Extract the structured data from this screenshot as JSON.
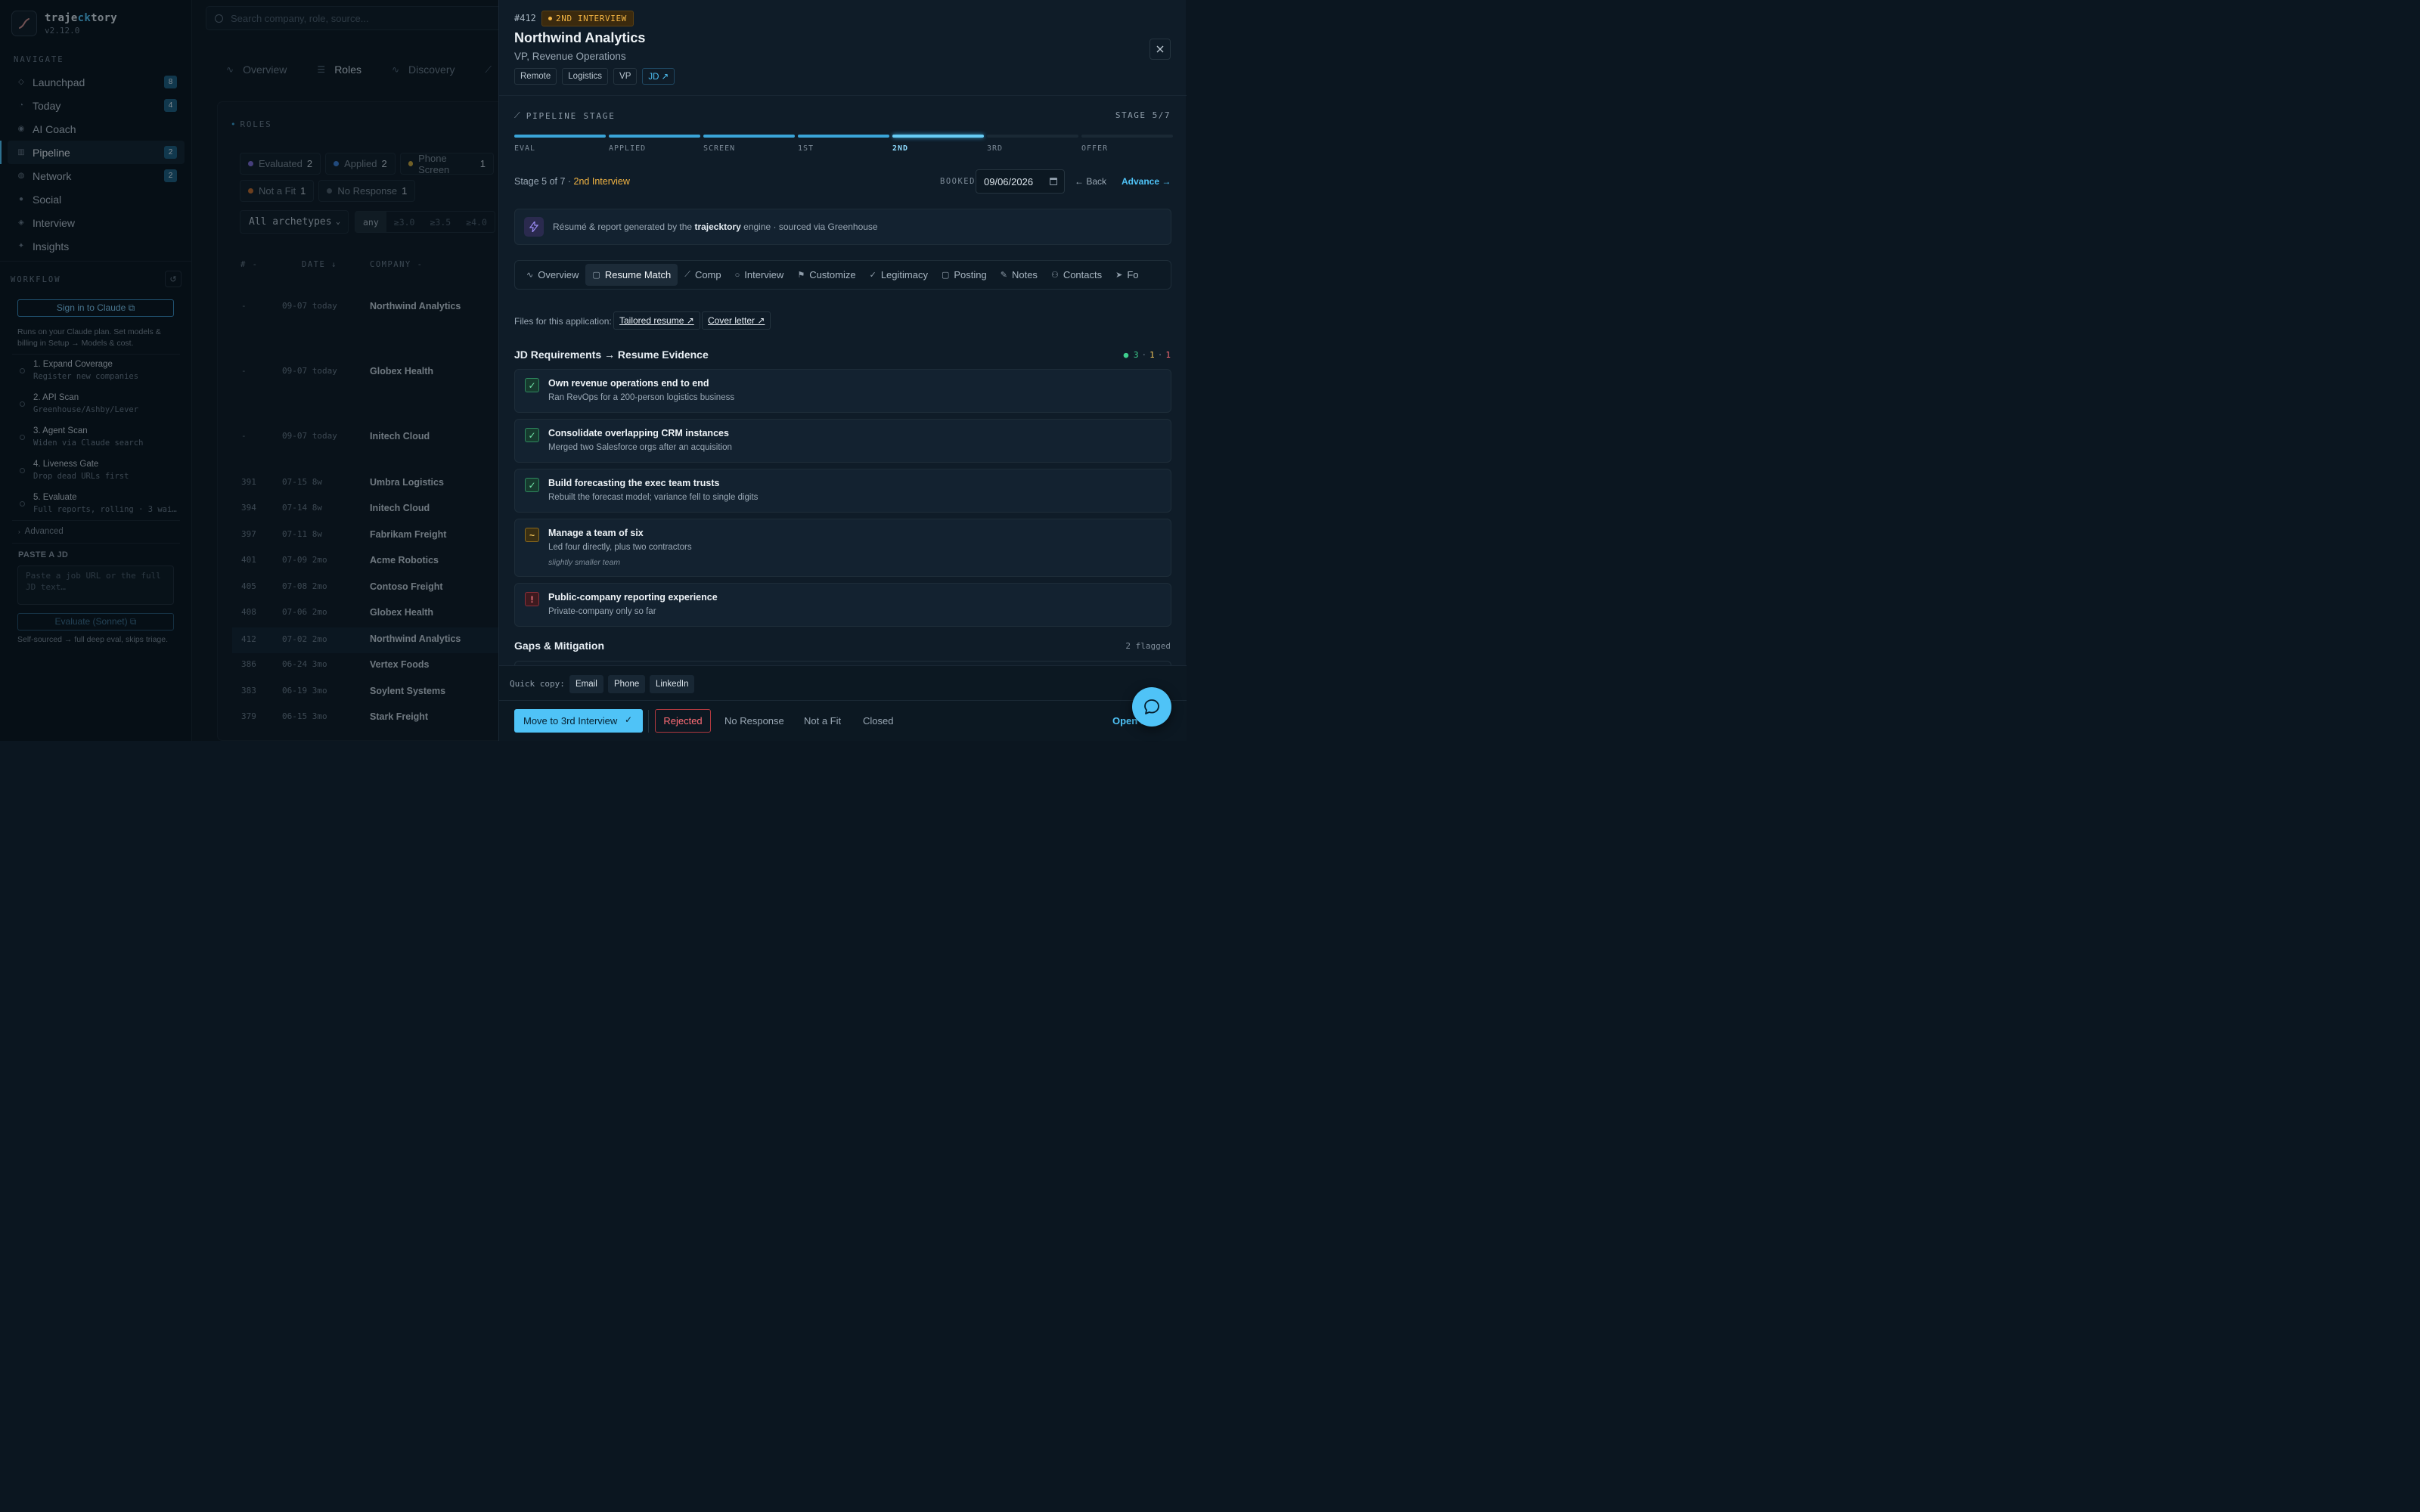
{
  "brand": {
    "name_prefix": "traje",
    "name_accent": "ck",
    "name_suffix": "tory",
    "version": "v2.12.0"
  },
  "sidebar": {
    "navigate_label": "NAVIGATE",
    "items": [
      {
        "label": "Launchpad",
        "icon": "diamond-icon",
        "badge": "8"
      },
      {
        "label": "Today",
        "icon": "clock-icon",
        "badge": "4"
      },
      {
        "label": "AI Coach",
        "icon": "target-icon",
        "badge": ""
      },
      {
        "label": "Pipeline",
        "icon": "grid-icon",
        "badge": "2",
        "active": true
      },
      {
        "label": "Network",
        "icon": "globe-icon",
        "badge": "2"
      },
      {
        "label": "Social",
        "icon": "circle-icon",
        "badge": ""
      },
      {
        "label": "Interview",
        "icon": "diamond-icon",
        "badge": ""
      },
      {
        "label": "Insights",
        "icon": "sparkle-icon",
        "badge": ""
      }
    ],
    "workflow_label": "WORKFLOW",
    "sign_in_label": "Sign in to Claude ⧉",
    "sign_in_note": "Runs on your Claude plan. Set models & billing in Setup → Models & cost.",
    "workflow_steps": [
      {
        "title": "1. Expand Coverage",
        "sub": "Register new companies"
      },
      {
        "title": "2. API Scan",
        "sub": "Greenhouse/Ashby/Lever"
      },
      {
        "title": "3. Agent Scan",
        "sub": "Widen via Claude search"
      },
      {
        "title": "4. Liveness Gate",
        "sub": "Drop dead URLs first"
      },
      {
        "title": "5. Evaluate",
        "sub": "Full reports, rolling · 3 wai…"
      }
    ],
    "advanced_label": "Advanced",
    "paste_label": "PASTE A JD",
    "paste_placeholder": "Paste a job URL or the full JD text…",
    "evaluate_label": "Evaluate (Sonnet) ⧉",
    "evaluate_note": "Self-sourced → full deep eval, skips triage."
  },
  "main": {
    "search_placeholder": "Search company, role, source...",
    "tabs": [
      "Overview",
      "Roles",
      "Discovery",
      "A"
    ],
    "roles_label": "ROLES",
    "filters_row1": [
      {
        "label": "Evaluated",
        "count": "2",
        "color": "#7d6bd6"
      },
      {
        "label": "Applied",
        "count": "2",
        "color": "#3a7fd8"
      },
      {
        "label": "Phone Screen",
        "count": "1",
        "color": "#c9a43a"
      }
    ],
    "filters_row2": [
      {
        "label": "Not a Fit",
        "count": "1",
        "color": "#c26a2a"
      },
      {
        "label": "No Response",
        "count": "1",
        "color": "#4f5d6a"
      }
    ],
    "archetype": "All archetypes",
    "score_options": [
      "any",
      "≥3.0",
      "≥3.5",
      "≥4.0"
    ],
    "col_id": "# -",
    "col_date": "DATE ↓",
    "col_company": "COMPANY -",
    "rows": [
      {
        "id": "-",
        "date": "09-07",
        "age": "today",
        "company": "Northwind Analytics"
      },
      {
        "id": "-",
        "date": "09-07",
        "age": "today",
        "company": "Globex Health"
      },
      {
        "id": "-",
        "date": "09-07",
        "age": "today",
        "company": "Initech Cloud"
      },
      {
        "id": "391",
        "date": "07-15",
        "age": "8w",
        "company": "Umbra Logistics"
      },
      {
        "id": "394",
        "date": "07-14",
        "age": "8w",
        "company": "Initech Cloud"
      },
      {
        "id": "397",
        "date": "07-11",
        "age": "8w",
        "company": "Fabrikam Freight"
      },
      {
        "id": "401",
        "date": "07-09",
        "age": "2mo",
        "company": "Acme Robotics"
      },
      {
        "id": "405",
        "date": "07-08",
        "age": "2mo",
        "company": "Contoso Freight"
      },
      {
        "id": "408",
        "date": "07-06",
        "age": "2mo",
        "company": "Globex Health"
      },
      {
        "id": "412",
        "date": "07-02",
        "age": "2mo",
        "company": "Northwind Analytics"
      },
      {
        "id": "386",
        "date": "06-24",
        "age": "3mo",
        "company": "Vertex Foods"
      },
      {
        "id": "383",
        "date": "06-19",
        "age": "3mo",
        "company": "Soylent Systems"
      },
      {
        "id": "379",
        "date": "06-15",
        "age": "3mo",
        "company": "Stark Freight"
      }
    ]
  },
  "drawer": {
    "id": "#412",
    "stage_badge": "2ND INTERVIEW",
    "company": "Northwind Analytics",
    "role": "VP, Revenue Operations",
    "tags": [
      "Remote",
      "Logistics",
      "VP",
      "JD ↗"
    ],
    "pipeline_label": "PIPELINE STAGE",
    "stage_count": "STAGE 5/7",
    "stages": [
      "EVAL",
      "APPLIED",
      "SCREEN",
      "1ST",
      "2ND",
      "3RD",
      "OFFER"
    ],
    "current_stage_index": 4,
    "stage_text_prefix": "Stage 5 of 7 · ",
    "stage_text_highlight": "2nd Interview",
    "booked_label": "BOOKED",
    "booked_date": "09/06/2026",
    "back_label": "← Back",
    "advance_label": "Advance →",
    "banner_prefix": "Résumé & report generated by the ",
    "banner_bold": "trajecktory",
    "banner_suffix": " engine · sourced via Greenhouse",
    "tabs": [
      {
        "label": "Overview",
        "icon": "pulse-icon"
      },
      {
        "label": "Resume Match",
        "icon": "briefcase-icon",
        "active": true
      },
      {
        "label": "Comp",
        "icon": "trend-icon"
      },
      {
        "label": "Interview",
        "icon": "chat-icon"
      },
      {
        "label": "Customize",
        "icon": "flag-icon"
      },
      {
        "label": "Legitimacy",
        "icon": "check-icon"
      },
      {
        "label": "Posting",
        "icon": "briefcase-icon"
      },
      {
        "label": "Notes",
        "icon": "pencil-icon"
      },
      {
        "label": "Contacts",
        "icon": "people-icon"
      },
      {
        "label": "Fo",
        "icon": "send-icon"
      }
    ],
    "files_label": "Files for this application:",
    "tailored_resume": "Tailored resume ↗",
    "cover_letter": "Cover letter ↗",
    "requirements_title": "JD Requirements → Resume Evidence",
    "tally": {
      "met": "3",
      "partial": "1",
      "gap": "1",
      "met_color": "#3ecf8e",
      "partial_color": "#f2c55a",
      "gap_color": "#ff6d76"
    },
    "requirements": [
      {
        "status": "ok",
        "symbol": "✓",
        "title": "Own revenue operations end to end",
        "evidence": "Ran RevOps for a 200-person logistics business",
        "note": ""
      },
      {
        "status": "ok",
        "symbol": "✓",
        "title": "Consolidate overlapping CRM instances",
        "evidence": "Merged two Salesforce orgs after an acquisition",
        "note": ""
      },
      {
        "status": "ok",
        "symbol": "✓",
        "title": "Build forecasting the exec team trusts",
        "evidence": "Rebuilt the forecast model; variance fell to single digits",
        "note": ""
      },
      {
        "status": "part",
        "symbol": "~",
        "title": "Manage a team of six",
        "evidence": "Led four directly, plus two contractors",
        "note": "slightly smaller team"
      },
      {
        "status": "gap",
        "symbol": "!",
        "title": "Public-company reporting experience",
        "evidence": "Private-company only so far",
        "note": ""
      }
    ],
    "gaps_title": "Gaps & Mitigation",
    "gaps_count": "2 flagged",
    "quick_copy_label": "Quick copy:",
    "quick_copy": [
      "Email",
      "Phone",
      "LinkedIn"
    ],
    "primary_action": "Move to 3rd Interview",
    "reject_label": "Rejected",
    "no_response_label": "No Response",
    "not_fit_label": "Not a Fit",
    "closed_label": "Closed",
    "open_label": "Open J"
  }
}
